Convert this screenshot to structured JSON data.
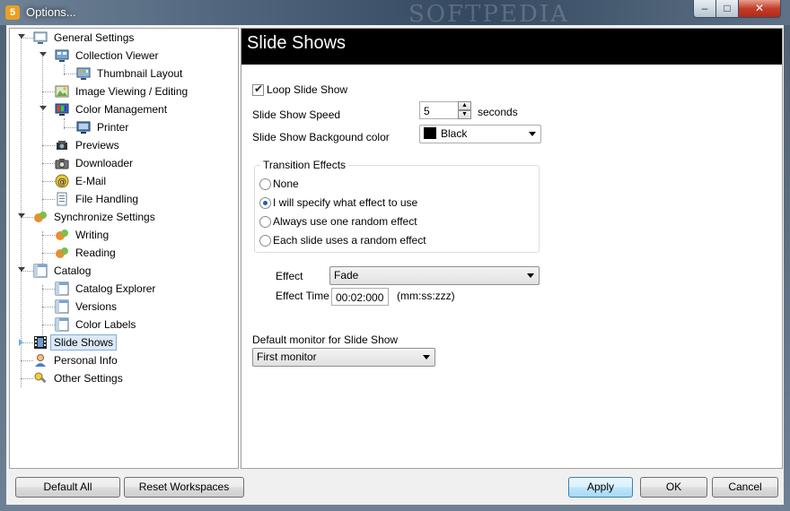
{
  "window": {
    "title": "Options...",
    "watermark": "SOFTPEDIA",
    "app_icon": "5",
    "controls": {
      "minimize": "–",
      "maximize": "□",
      "close": "✕"
    }
  },
  "tree": {
    "items": [
      {
        "label": "General Settings",
        "icon": "monitor-icon"
      },
      {
        "label": "Collection Viewer",
        "icon": "collection-viewer-icon"
      },
      {
        "label": "Thumbnail Layout",
        "icon": "thumbnail-icon"
      },
      {
        "label": "Image Viewing / Editing",
        "icon": "image-edit-icon"
      },
      {
        "label": "Color Management",
        "icon": "color-monitor-icon"
      },
      {
        "label": "Printer",
        "icon": "printer-monitor-icon"
      },
      {
        "label": "Previews",
        "icon": "previews-icon"
      },
      {
        "label": "Downloader",
        "icon": "camera-icon"
      },
      {
        "label": "E-Mail",
        "icon": "email-icon"
      },
      {
        "label": "File Handling",
        "icon": "file-icon"
      },
      {
        "label": "Synchronize Settings",
        "icon": "sync-icon"
      },
      {
        "label": "Writing",
        "icon": "sync-write-icon"
      },
      {
        "label": "Reading",
        "icon": "sync-read-icon"
      },
      {
        "label": "Catalog",
        "icon": "catalog-icon"
      },
      {
        "label": "Catalog Explorer",
        "icon": "catalog-explorer-icon"
      },
      {
        "label": "Versions",
        "icon": "versions-icon"
      },
      {
        "label": "Color Labels",
        "icon": "color-labels-icon"
      },
      {
        "label": "Slide Shows",
        "icon": "film-icon"
      },
      {
        "label": "Personal Info",
        "icon": "person-icon"
      },
      {
        "label": "Other Settings",
        "icon": "tools-icon"
      }
    ]
  },
  "content": {
    "title": "Slide Shows",
    "loop_label": "Loop Slide Show",
    "loop_checked": true,
    "speed_label": "Slide Show Speed",
    "speed_value": "5",
    "speed_unit": "seconds",
    "bgcolor_label": "Slide Show Backgound color",
    "bgcolor_value": "Black",
    "bgcolor_swatch": "#000000",
    "transition": {
      "title": "Transition Effects",
      "options": [
        "None",
        "I will specify what effect to use",
        "Always use one random effect",
        "Each slide uses a random effect"
      ],
      "selected_index": 1
    },
    "effect_label": "Effect",
    "effect_value": "Fade",
    "effect_time_label": "Effect Time",
    "effect_time_value": "00:02:000",
    "effect_time_format": "(mm:ss:zzz)",
    "monitor_label": "Default monitor for Slide Show",
    "monitor_value": "First monitor"
  },
  "footer": {
    "default_all": "Default All",
    "reset_workspaces": "Reset Workspaces",
    "apply": "Apply",
    "ok": "OK",
    "cancel": "Cancel"
  },
  "colors": {
    "header_bg": "#000000",
    "selection_bg": "#dbe9f7",
    "selection_border": "#84acdd"
  }
}
